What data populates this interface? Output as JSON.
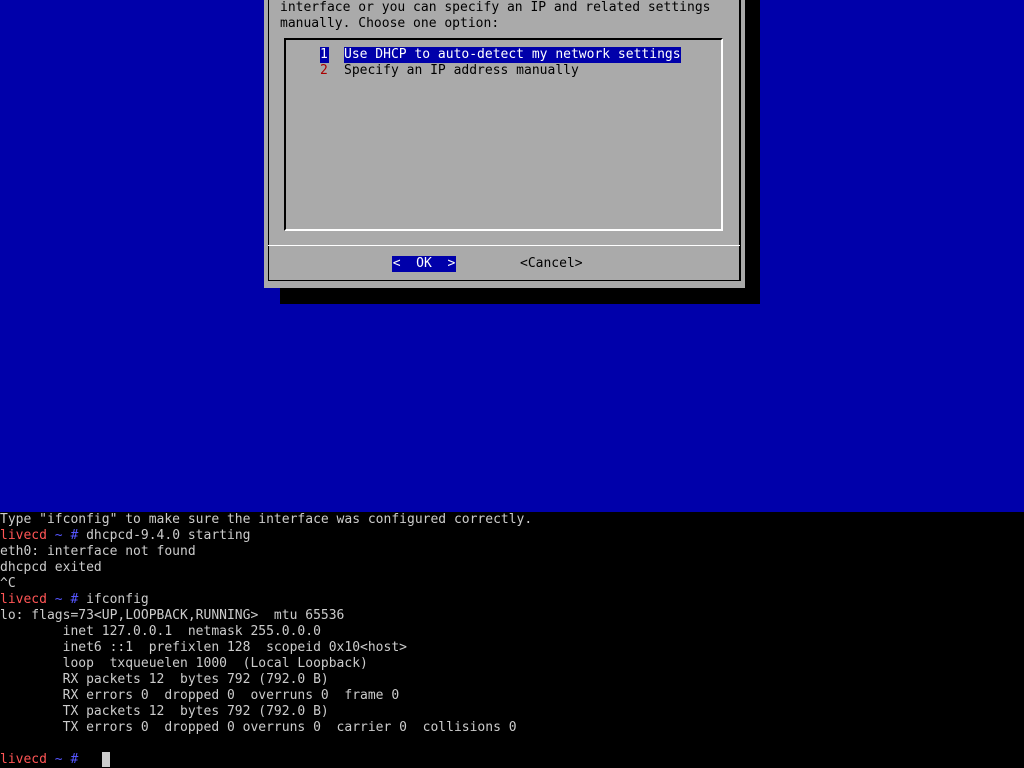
{
  "dialog": {
    "text_line_1": "interface or you can specify an IP and related settings",
    "text_line_2": "manually. Choose one option:",
    "menu_items": [
      {
        "tag": "1",
        "label": "Use DHCP to auto-detect my network settings",
        "selected": true
      },
      {
        "tag": "2",
        "label": "Specify an IP address manually",
        "selected": false
      }
    ],
    "ok_label": "<  OK  >",
    "cancel_label": "<Cancel>"
  },
  "terminal": {
    "hint": "Type \"ifconfig\" to make sure the interface was configured correctly.",
    "prompt": {
      "host": "livecd",
      "path": "~",
      "hash": "#"
    },
    "lines": [
      {
        "prompt": true,
        "cmd": "dhcpcd-9.4.0 starting"
      },
      {
        "text": "eth0: interface not found"
      },
      {
        "text": "dhcpcd exited"
      },
      {
        "text": "^C"
      },
      {
        "prompt": true,
        "cmd": "ifconfig"
      },
      {
        "text": "lo: flags=73<UP,LOOPBACK,RUNNING>  mtu 65536"
      },
      {
        "text": "        inet 127.0.0.1  netmask 255.0.0.0"
      },
      {
        "text": "        inet6 ::1  prefixlen 128  scopeid 0x10<host>"
      },
      {
        "text": "        loop  txqueuelen 1000  (Local Loopback)"
      },
      {
        "text": "        RX packets 12  bytes 792 (792.0 B)"
      },
      {
        "text": "        RX errors 0  dropped 0  overruns 0  frame 0"
      },
      {
        "text": "        TX packets 12  bytes 792 (792.0 B)"
      },
      {
        "text": "        TX errors 0  dropped 0 overruns 0  carrier 0  collisions 0"
      },
      {
        "text": ""
      },
      {
        "prompt": true,
        "cmd": "",
        "cursor": true
      }
    ]
  },
  "colors": {
    "background": "#0000aa",
    "dialog": "#aaaaaa",
    "highlight": "#0000aa",
    "tag": "#aa0000",
    "prompt_host": "#ff5555",
    "prompt_path": "#5555ff"
  }
}
